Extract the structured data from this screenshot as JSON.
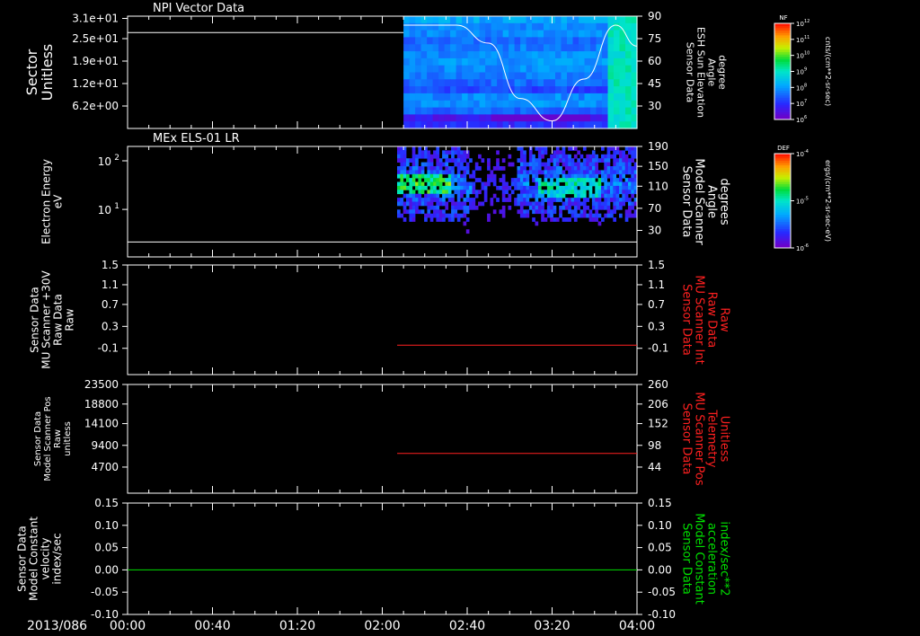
{
  "date_label": "2013/086",
  "time_ticks": [
    "00:00",
    "00:40",
    "01:20",
    "02:00",
    "02:40",
    "03:20",
    "04:00"
  ],
  "panels": [
    {
      "id": "npi",
      "title": "NPI Vector Data",
      "left_label": [
        "Sector",
        "Unitless"
      ],
      "left_ticks": [
        "3.1e+01",
        "2.5e+01",
        "1.9e+01",
        "1.2e+01",
        "6.2e+00"
      ],
      "right_label": [
        "Sensor Data",
        "ESH Sun Elevation",
        "Angle",
        "degree"
      ],
      "right_ticks": [
        "90",
        "75",
        "60",
        "45",
        "30"
      ],
      "right_label_color": "#ffffff"
    },
    {
      "id": "els",
      "title": "MEx ELS-01 LR",
      "left_label": [
        "Electron Energy",
        "eV"
      ],
      "left_ticks_sup": [
        {
          "base": "10",
          "exp": "2"
        },
        {
          "base": "10",
          "exp": "1"
        }
      ],
      "right_label": [
        "Sensor Data",
        "Model Scanner",
        "Angle",
        "degrees"
      ],
      "right_ticks": [
        "190",
        "150",
        "110",
        "70",
        "30"
      ],
      "right_label_color": "#ffffff"
    },
    {
      "id": "mu30",
      "title": "",
      "left_label": [
        "Sensor Data",
        "MU Scanner +30V",
        "Raw Data",
        "Raw"
      ],
      "left_ticks": [
        "1.5",
        "1.1",
        "0.7",
        "0.3",
        "-0.1"
      ],
      "right_label": [
        "Sensor Data",
        "MU Scanner Int",
        "Raw Data",
        "Raw"
      ],
      "right_ticks": [
        "1.5",
        "1.1",
        "0.7",
        "0.3",
        "-0.1"
      ],
      "right_label_color": "#ff2020"
    },
    {
      "id": "pos",
      "title": "",
      "left_label": [
        "Sensor Data",
        "Model Scanner Pos",
        "Raw",
        "unitless"
      ],
      "left_ticks": [
        "23500",
        "18800",
        "14100",
        "9400",
        "4700"
      ],
      "right_label": [
        "Sensor Data",
        "MU Scanner Pos",
        "Telemetry",
        "Unitless"
      ],
      "right_ticks": [
        "260",
        "206",
        "152",
        "98",
        "44"
      ],
      "right_label_color": "#ff2020"
    },
    {
      "id": "vel",
      "title": "",
      "left_label": [
        "Sensor Data",
        "Model Constant",
        "velocity",
        "index/sec"
      ],
      "left_ticks": [
        "0.15",
        "0.10",
        "0.05",
        "0.00",
        "-0.05",
        "-0.10"
      ],
      "right_label": [
        "Sensor Data",
        "Model Constant",
        "acceleration",
        "index/sec**2"
      ],
      "right_ticks": [
        "0.15",
        "0.10",
        "0.05",
        "0.00",
        "-0.05",
        "-0.10"
      ],
      "right_label_color": "#00e000"
    }
  ],
  "colorbars": [
    {
      "id": "nf",
      "name": "NF",
      "units": "cnts/(cm**2-sr-sec)",
      "ticks_exp": [
        "12",
        "11",
        "10",
        "9",
        "8",
        "7",
        "6"
      ]
    },
    {
      "id": "def",
      "name": "DEF",
      "units": "ergs/(cm**2-sr-sec-eV)",
      "ticks_exp": [
        "-4",
        "-5",
        "-6"
      ]
    }
  ],
  "chart_data": {
    "type": "line",
    "time_range": [
      "00:00",
      "04:00"
    ],
    "series": [
      {
        "panel": "npi",
        "kind": "line",
        "color": "#ffffff",
        "x": [
          "00:00",
          "02:10"
        ],
        "y": [
          27,
          27
        ]
      },
      {
        "panel": "npi",
        "kind": "line",
        "color": "#ffffff",
        "axis": "right",
        "x": [
          "02:10",
          "02:35",
          "02:50",
          "03:05",
          "03:20",
          "03:35",
          "03:50",
          "04:00"
        ],
        "y": [
          84,
          84,
          72,
          35,
          20,
          48,
          84,
          70
        ]
      },
      {
        "panel": "els",
        "kind": "line",
        "color": "#ffffff",
        "axis": "right",
        "x": [
          "00:00",
          "04:00"
        ],
        "y": [
          8,
          8
        ]
      },
      {
        "panel": "mu30",
        "kind": "line",
        "color": "#ff2020",
        "x": [
          "02:07",
          "04:00"
        ],
        "y": [
          -0.04,
          -0.04
        ]
      },
      {
        "panel": "pos",
        "kind": "line",
        "color": "#ff2020",
        "x": [
          "02:07",
          "04:00"
        ],
        "y": [
          7800,
          7800
        ]
      },
      {
        "panel": "vel",
        "kind": "line",
        "color": "#00e000",
        "x": [
          "00:00",
          "04:00"
        ],
        "y": [
          0.0,
          0.0
        ]
      }
    ],
    "spectrograms": [
      {
        "panel": "npi",
        "x_start": "02:10",
        "x_end": "04:00",
        "quantity": "NF"
      },
      {
        "panel": "els",
        "x_start": "02:07",
        "x_end": "04:00",
        "quantity": "DEF"
      }
    ]
  }
}
